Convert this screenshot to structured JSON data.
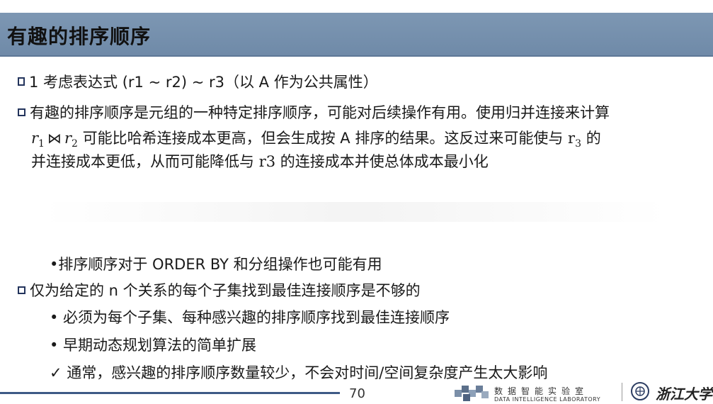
{
  "slide": {
    "title": "有趣的排序顺序",
    "line1": "1 考虑表达式 (r1 ~ r2) ~ r3（以 A 作为公共属性）",
    "line2": "有趣的排序顺序是元组的一种特定排序顺序，可能对后续操作有用。使用归并连接来计算",
    "line3_r1": "r",
    "line3_r1_sub": "1",
    "line3_join": "⋈",
    "line3_r2": "r",
    "line3_r2_sub": "2",
    "line3_text": "可能比哈希连接成本更高，但会生成按 A 排序的结果。这反过来可能使与",
    "line3_r3": "r",
    "line3_r3_sub": "3",
    "line3_end": "的",
    "line4_a": "并连接成本更低，从而可能降低与",
    "line4_r3": "r3",
    "line4_b": "的连接成本并使总体成本最小化",
    "line5": "•排序顺序对于 ORDER BY 和分组操作也可能有用",
    "line6": "仅为给定的 n 个关系的每个子集找到最佳连接顺序是不够的",
    "line7": "• 必须为每个子集、每种感兴趣的排序顺序找到最佳连接顺序",
    "line8": "• 早期动态规划算法的简单扩展",
    "line9": "✓ 通常，感兴趣的排序顺序数量较少，不会对时间/空间复杂度产生太大影响"
  },
  "footer": {
    "page_number": "70",
    "lab_name_cn": "数据智能实验室",
    "lab_name_en": "DATA INTELLIGENCE LABORATORY",
    "university": "浙江大学"
  },
  "colors": {
    "title_bar": "#7089a7",
    "bullet": "#23345c",
    "footer_bar": "#3e5a86"
  }
}
